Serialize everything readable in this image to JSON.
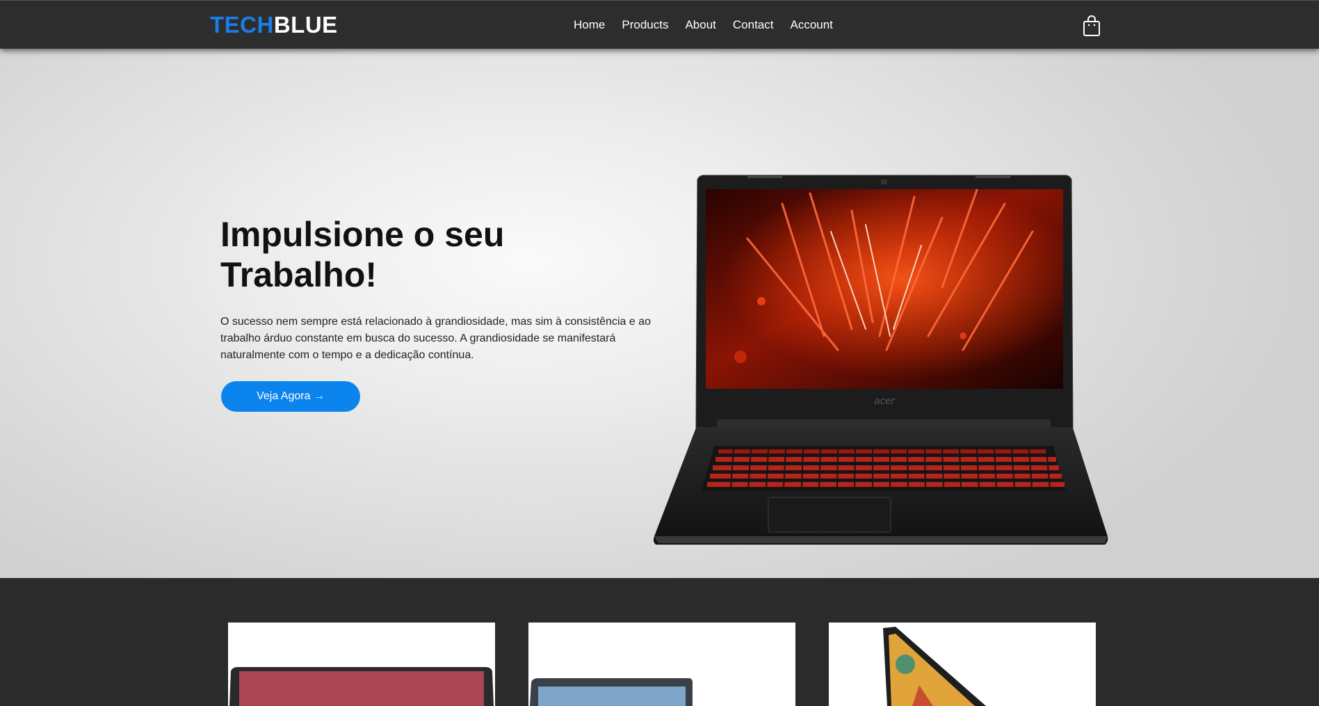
{
  "brand": {
    "part1": "TECH",
    "part2": "BLUE"
  },
  "nav": {
    "items": [
      {
        "label": "Home"
      },
      {
        "label": "Products"
      },
      {
        "label": "About"
      },
      {
        "label": "Contact"
      },
      {
        "label": "Account"
      }
    ],
    "cart_icon": "shopping-bag-icon"
  },
  "hero": {
    "title": "Impulsione o seu Trabalho!",
    "text": "O sucesso nem sempre está relacionado à grandiosidade, mas sim à consistência e ao trabalho árduo constante em busca do sucesso. A grandiosidade se manifestará naturalmente com o tempo e a dedicação contínua.",
    "button_label": "Veja Agora →",
    "laptop_logo": "acer"
  },
  "colors": {
    "accent": "#0b84ee",
    "brand_blue": "#1a7ee6",
    "navbar": "#2d2d2d",
    "footer_section": "#2b2b2b"
  }
}
